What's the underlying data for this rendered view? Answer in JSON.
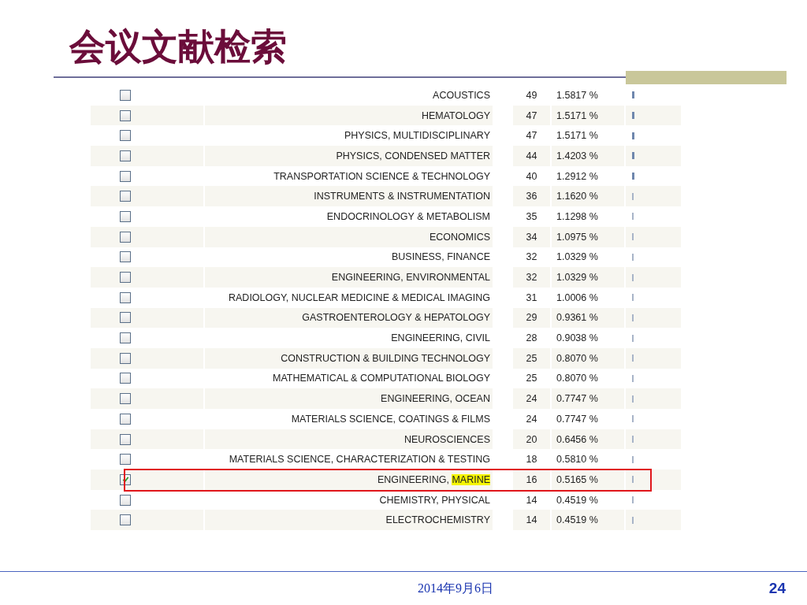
{
  "slide": {
    "title": "会议文献检索",
    "date": "2014年9月6日",
    "page_number": "24"
  },
  "table": {
    "rows": [
      {
        "checked": false,
        "marked": false,
        "name": "ACOUSTICS",
        "count": "49",
        "percent": "1.5817 %"
      },
      {
        "checked": false,
        "marked": false,
        "name": "HEMATOLOGY",
        "count": "47",
        "percent": "1.5171 %"
      },
      {
        "checked": false,
        "marked": false,
        "name": "PHYSICS, MULTIDISCIPLINARY",
        "count": "47",
        "percent": "1.5171 %"
      },
      {
        "checked": false,
        "marked": false,
        "name": "PHYSICS, CONDENSED MATTER",
        "count": "44",
        "percent": "1.4203 %"
      },
      {
        "checked": false,
        "marked": false,
        "name": "TRANSPORTATION SCIENCE & TECHNOLOGY",
        "count": "40",
        "percent": "1.2912 %"
      },
      {
        "checked": false,
        "marked": false,
        "name": "INSTRUMENTS & INSTRUMENTATION",
        "count": "36",
        "percent": "1.1620 %"
      },
      {
        "checked": false,
        "marked": false,
        "name": "ENDOCRINOLOGY & METABOLISM",
        "count": "35",
        "percent": "1.1298 %"
      },
      {
        "checked": false,
        "marked": false,
        "name": "ECONOMICS",
        "count": "34",
        "percent": "1.0975 %"
      },
      {
        "checked": false,
        "marked": false,
        "name": "BUSINESS, FINANCE",
        "count": "32",
        "percent": "1.0329 %"
      },
      {
        "checked": false,
        "marked": false,
        "name": "ENGINEERING, ENVIRONMENTAL",
        "count": "32",
        "percent": "1.0329 %"
      },
      {
        "checked": false,
        "marked": false,
        "name": "RADIOLOGY, NUCLEAR MEDICINE & MEDICAL IMAGING",
        "count": "31",
        "percent": "1.0006 %"
      },
      {
        "checked": false,
        "marked": false,
        "name": "GASTROENTEROLOGY & HEPATOLOGY",
        "count": "29",
        "percent": "0.9361 %"
      },
      {
        "checked": false,
        "marked": false,
        "name": "ENGINEERING, CIVIL",
        "count": "28",
        "percent": "0.9038 %"
      },
      {
        "checked": false,
        "marked": false,
        "name": "CONSTRUCTION & BUILDING TECHNOLOGY",
        "count": "25",
        "percent": "0.8070 %"
      },
      {
        "checked": false,
        "marked": false,
        "name": "MATHEMATICAL & COMPUTATIONAL BIOLOGY",
        "count": "25",
        "percent": "0.8070 %"
      },
      {
        "checked": false,
        "marked": false,
        "name": "ENGINEERING, OCEAN",
        "count": "24",
        "percent": "0.7747 %"
      },
      {
        "checked": false,
        "marked": false,
        "name": "MATERIALS SCIENCE, COATINGS & FILMS",
        "count": "24",
        "percent": "0.7747 %"
      },
      {
        "checked": false,
        "marked": false,
        "name": "NEUROSCIENCES",
        "count": "20",
        "percent": "0.6456 %"
      },
      {
        "checked": false,
        "marked": false,
        "name": "MATERIALS SCIENCE, CHARACTERIZATION & TESTING",
        "count": "18",
        "percent": "0.5810 %"
      },
      {
        "checked": true,
        "marked": true,
        "name": "ENGINEERING,",
        "highlight": "MARINE",
        "count": "16",
        "percent": "0.5165 %"
      },
      {
        "checked": false,
        "marked": false,
        "name": "CHEMISTRY, PHYSICAL",
        "count": "14",
        "percent": "0.4519 %"
      },
      {
        "checked": false,
        "marked": false,
        "name": "ELECTROCHEMISTRY",
        "count": "14",
        "percent": "0.4519 %"
      }
    ]
  }
}
